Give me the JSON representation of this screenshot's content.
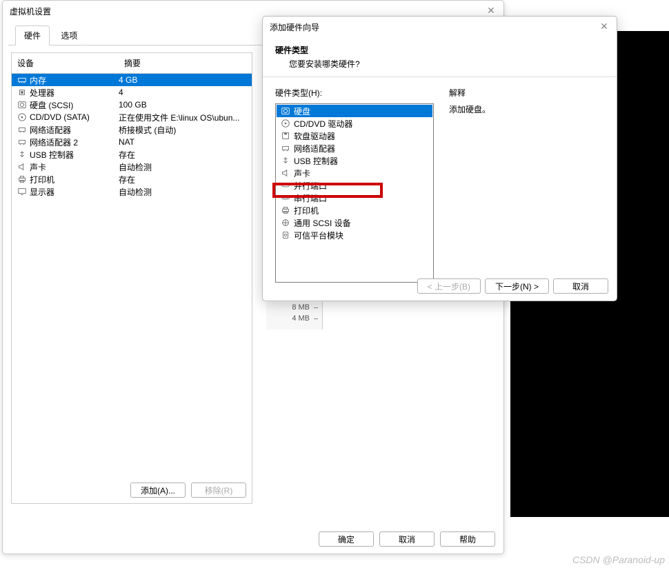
{
  "settings": {
    "title": "虚拟机设置",
    "tabs": [
      "硬件",
      "选项"
    ],
    "active_tab": 0,
    "columns": {
      "device": "设备",
      "summary": "摘要"
    },
    "rows": [
      {
        "icon": "memory-icon",
        "device": "内存",
        "summary": "4 GB",
        "selected": true
      },
      {
        "icon": "cpu-icon",
        "device": "处理器",
        "summary": "4"
      },
      {
        "icon": "disk-icon",
        "device": "硬盘 (SCSI)",
        "summary": "100 GB"
      },
      {
        "icon": "cd-icon",
        "device": "CD/DVD (SATA)",
        "summary": "正在使用文件 E:\\linux OS\\ubun..."
      },
      {
        "icon": "network-icon",
        "device": "网络适配器",
        "summary": "桥接模式 (自动)"
      },
      {
        "icon": "network-icon",
        "device": "网络适配器 2",
        "summary": "NAT"
      },
      {
        "icon": "usb-icon",
        "device": "USB 控制器",
        "summary": "存在"
      },
      {
        "icon": "sound-icon",
        "device": "声卡",
        "summary": "自动检测"
      },
      {
        "icon": "printer-icon",
        "device": "打印机",
        "summary": "存在"
      },
      {
        "icon": "display-icon",
        "device": "显示器",
        "summary": "自动检测"
      }
    ],
    "add_btn": "添加(A)...",
    "remove_btn": "移除(R)",
    "ok_btn": "确定",
    "cancel_btn": "取消",
    "help_btn": "帮助",
    "mem_ticks": [
      "8 MB",
      "4 MB"
    ]
  },
  "wizard": {
    "title": "添加硬件向导",
    "header_bold": "硬件类型",
    "header_sub": "您要安装哪类硬件?",
    "type_label": "硬件类型(H):",
    "explain_label": "解释",
    "explain_text": "添加硬盘。",
    "types": [
      {
        "icon": "disk-icon",
        "label": "硬盘",
        "selected": true
      },
      {
        "icon": "cd-icon",
        "label": "CD/DVD 驱动器"
      },
      {
        "icon": "floppy-icon",
        "label": "软盘驱动器"
      },
      {
        "icon": "network-icon",
        "label": "网络适配器"
      },
      {
        "icon": "usb-icon",
        "label": "USB 控制器"
      },
      {
        "icon": "sound-icon",
        "label": "声卡"
      },
      {
        "icon": "parallel-icon",
        "label": "并行端口"
      },
      {
        "icon": "serial-icon",
        "label": "串行端口",
        "highlighted": true
      },
      {
        "icon": "printer-icon",
        "label": "打印机"
      },
      {
        "icon": "scsi-icon",
        "label": "通用 SCSI 设备"
      },
      {
        "icon": "tpm-icon",
        "label": "可信平台模块"
      }
    ],
    "back_btn": "< 上一步(B)",
    "next_btn": "下一步(N) >",
    "cancel_btn": "取消"
  },
  "watermark": "CSDN @Paranoid-up"
}
